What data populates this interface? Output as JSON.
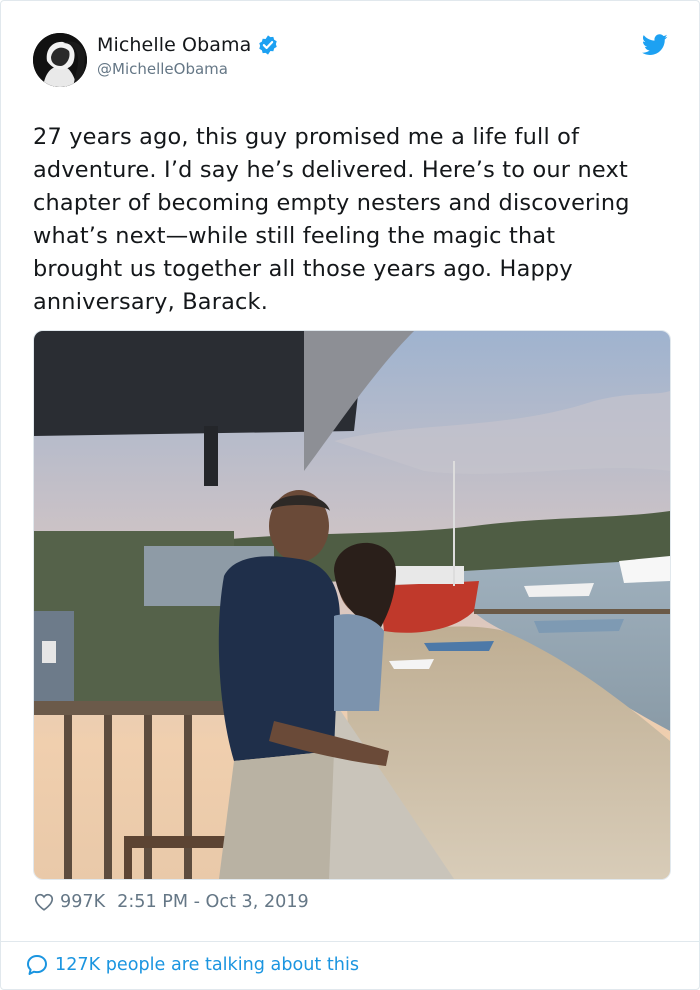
{
  "author": {
    "name": "Michelle Obama",
    "handle": "@MichelleObama",
    "verified": true,
    "avatar_icon": "profile-photo"
  },
  "tweet": {
    "text": "27 years ago, this guy promised me a life full of\nadventure. I’d say he’s delivered. Here’s to our next\nchapter of becoming empty nesters and discovering\nwhat’s next—while still feeling the magic that\nbrought us together all those years ago. Happy\nanniversary, Barack."
  },
  "media": {
    "icon": "photo-couple-on-deck-by-harbor"
  },
  "stats": {
    "likes": "997K",
    "timestamp": "2:51 PM - Oct 3, 2019"
  },
  "footer": {
    "conversation_label": "127K people are talking about this"
  },
  "colors": {
    "twitter_blue": "#1da1f2",
    "link_blue": "#1b95e0",
    "secondary_text": "#657786",
    "border": "#e1e8ed"
  }
}
